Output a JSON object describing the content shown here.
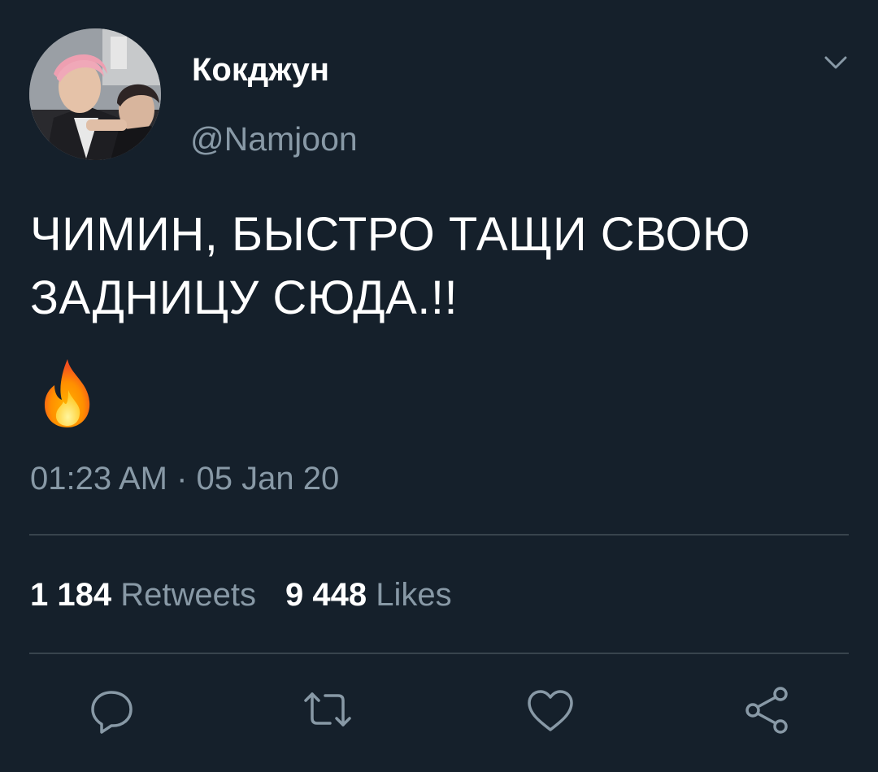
{
  "user": {
    "display_name": "Кокджун",
    "handle": "@Namjoon"
  },
  "tweet": {
    "text": "ЧИМИН, БЫСТРО ТАЩИ СВОЮ ЗАДНИЦУ СЮДА.!!",
    "emoji": "fire-emoji",
    "timestamp": "01:23 AM · 05 Jan 20"
  },
  "stats": {
    "retweets_count": "1 184",
    "retweets_label": "Retweets",
    "likes_count": "9 448",
    "likes_label": "Likes"
  },
  "icons": {
    "menu": "chevron-down-icon",
    "reply": "reply-icon",
    "retweet": "retweet-icon",
    "like": "heart-icon",
    "share": "share-icon"
  },
  "colors": {
    "background": "#15202b",
    "primary_text": "#ffffff",
    "secondary_text": "#8899a6",
    "divider": "#38444d"
  }
}
